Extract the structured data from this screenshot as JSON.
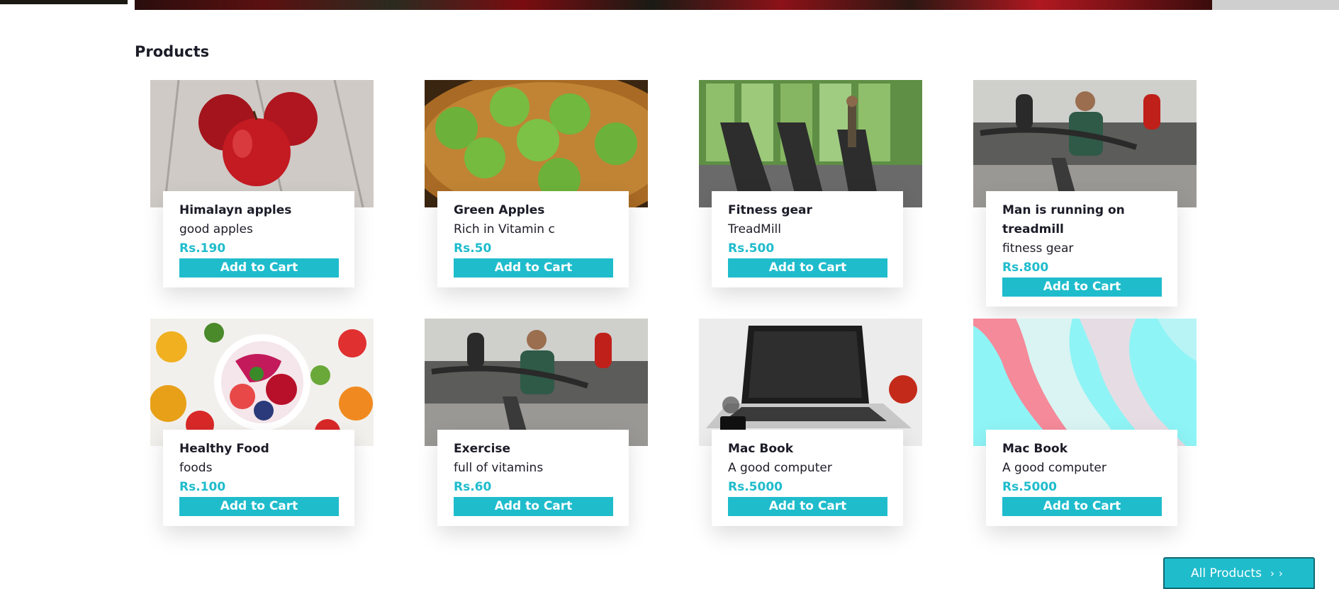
{
  "section": {
    "title": "Products"
  },
  "products": [
    {
      "name": "Himalayn apples",
      "desc": "good apples",
      "price": "Rs.190",
      "button": "Add to Cart",
      "image": "red-apples"
    },
    {
      "name": "Green Apples",
      "desc": "Rich in Vitamin c",
      "price": "Rs.50",
      "button": "Add to Cart",
      "image": "green-apples-in-water"
    },
    {
      "name": "Fitness gear",
      "desc": "TreadMill",
      "price": "Rs.500",
      "button": "Add to Cart",
      "image": "gym-treadmills"
    },
    {
      "name": "Man is running on treadmill",
      "desc": "fitness gear",
      "price": "Rs.800",
      "button": "Add to Cart",
      "image": "man-on-treadmill"
    },
    {
      "name": "Healthy Food",
      "desc": "foods",
      "price": "Rs.100",
      "button": "Add to Cart",
      "image": "fruit-bowl"
    },
    {
      "name": "Exercise",
      "desc": "full of vitamins",
      "price": "Rs.60",
      "button": "Add to Cart",
      "image": "man-on-treadmill"
    },
    {
      "name": "Mac Book",
      "desc": "A good computer",
      "price": "Rs.5000",
      "button": "Add to Cart",
      "image": "laptop-with-apple"
    },
    {
      "name": "Mac Book",
      "desc": "A good computer",
      "price": "Rs.5000",
      "button": "Add to Cart",
      "image": "pink-cyan-abstract"
    }
  ],
  "all_products_button": {
    "label": "All Products",
    "icon": "chevron-right-icon"
  },
  "colors": {
    "accent": "#1fbccc",
    "text": "#1c1c28"
  }
}
